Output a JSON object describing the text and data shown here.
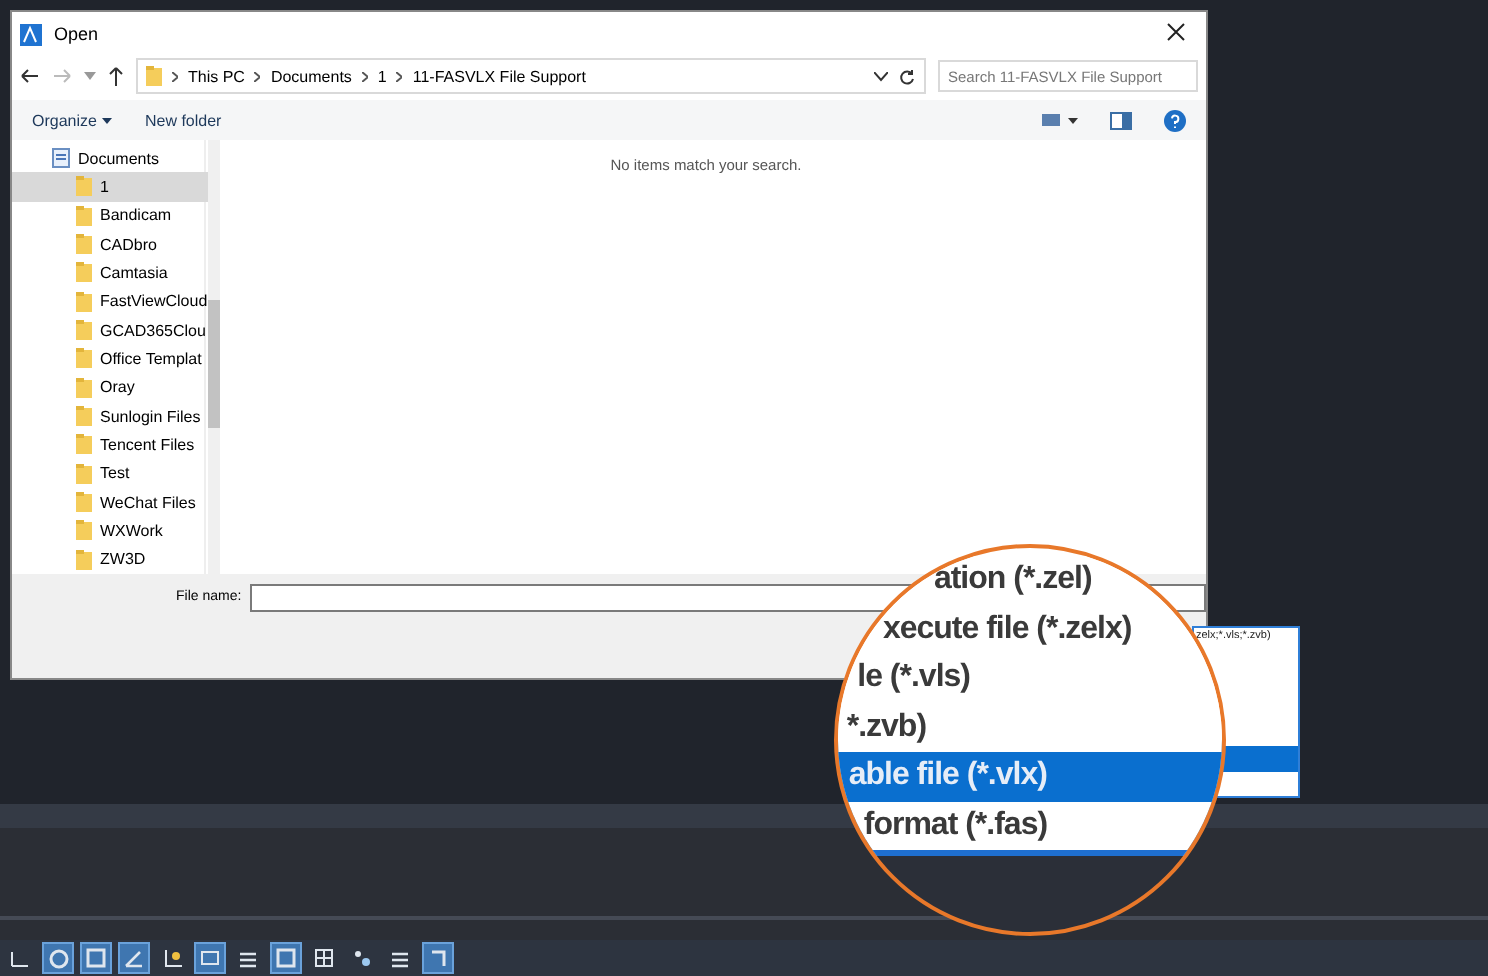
{
  "window": {
    "title": "Open"
  },
  "address_bar": {
    "path": [
      "This PC",
      "Documents",
      "1",
      "11-FASVLX File Support"
    ]
  },
  "search": {
    "placeholder": "Search 11-FASVLX File Support"
  },
  "toolbar": {
    "organize": "Organize",
    "new_folder": "New folder"
  },
  "navigation_pane": {
    "items": [
      {
        "label": "Documents",
        "kind": "library",
        "selected": false,
        "children": [
          {
            "label": "1",
            "kind": "folder",
            "selected": true
          },
          {
            "label": "Bandicam",
            "kind": "folder",
            "selected": false
          },
          {
            "label": "CADbro",
            "kind": "folder",
            "selected": false
          },
          {
            "label": "Camtasia",
            "kind": "folder",
            "selected": false
          },
          {
            "label": "FastViewCloud",
            "kind": "folder",
            "selected": false
          },
          {
            "label": "GCAD365Clou",
            "kind": "folder",
            "selected": false
          },
          {
            "label": "Office Templat",
            "kind": "folder",
            "selected": false
          },
          {
            "label": "Oray",
            "kind": "folder",
            "selected": false
          },
          {
            "label": "Sunlogin Files",
            "kind": "folder",
            "selected": false
          },
          {
            "label": "Tencent Files",
            "kind": "folder",
            "selected": false
          },
          {
            "label": "Test",
            "kind": "folder",
            "selected": false
          },
          {
            "label": "WeChat Files",
            "kind": "folder",
            "selected": false
          },
          {
            "label": "WXWork",
            "kind": "folder",
            "selected": false
          },
          {
            "label": "ZW3D",
            "kind": "folder",
            "selected": false
          }
        ]
      }
    ]
  },
  "content": {
    "empty_message": "No items match your search."
  },
  "file_name": {
    "label": "File name:"
  },
  "file_type_combo": {
    "value": "zelx;*.vls;*.zvb)"
  },
  "magnified_file_types": [
    {
      "label": "ation (*.zel)",
      "selected": false
    },
    {
      "label": "xecute file (*.zelx)",
      "selected": false
    },
    {
      "label": "le (*.vls)",
      "selected": false
    },
    {
      "label": "*.zvb)",
      "selected": false
    },
    {
      "label": "able file (*.vlx)",
      "selected": true
    },
    {
      "label": "format (*.fas)",
      "selected": false
    }
  ],
  "status_bar": {
    "tools": [
      {
        "kind": "snap",
        "active": false
      },
      {
        "kind": "circle",
        "active": true
      },
      {
        "kind": "square",
        "active": true
      },
      {
        "kind": "angle",
        "active": true
      },
      {
        "kind": "axes",
        "active": false
      },
      {
        "kind": "monitor",
        "active": true
      },
      {
        "kind": "lines",
        "active": false
      },
      {
        "kind": "square",
        "active": true
      },
      {
        "kind": "table",
        "active": false
      },
      {
        "kind": "dots",
        "active": false
      },
      {
        "kind": "lines",
        "active": false
      },
      {
        "kind": "corner",
        "active": true
      }
    ]
  }
}
